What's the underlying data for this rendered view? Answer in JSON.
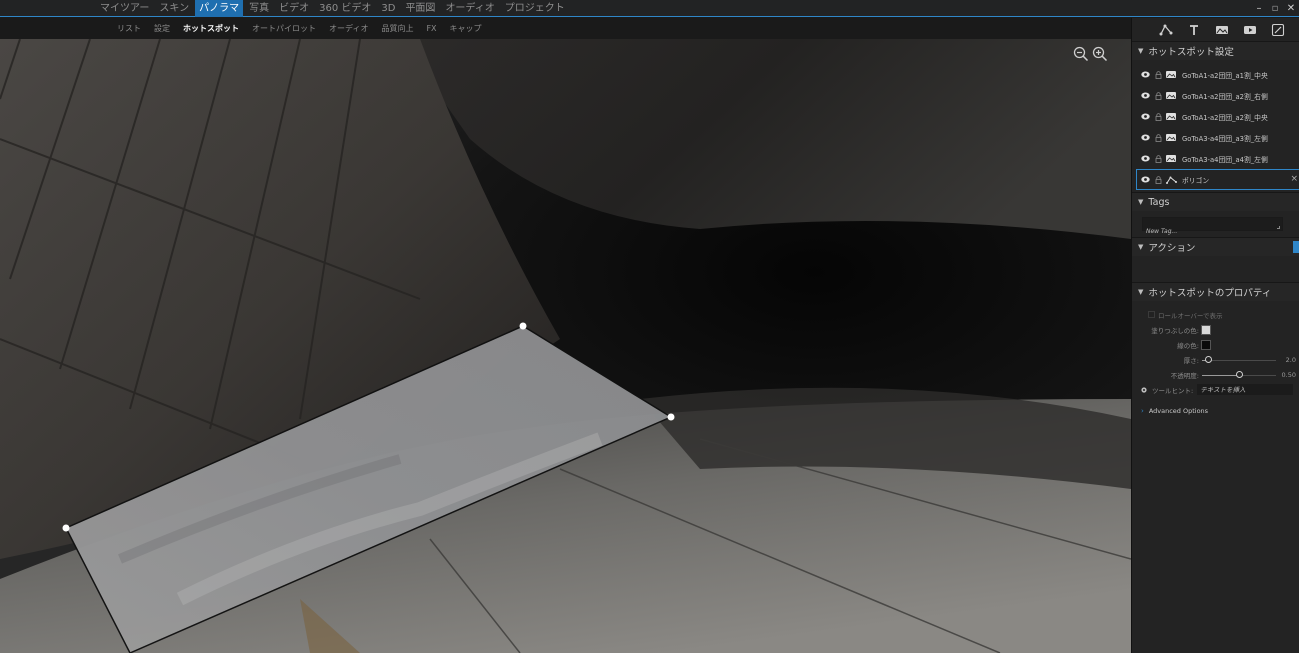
{
  "colors": {
    "accent": "#2f86c8",
    "activeTab": "#1f6fb0",
    "panel": "#232323",
    "topbar": "#222324"
  },
  "topnav": {
    "items": [
      {
        "label": "マイツアー",
        "active": false
      },
      {
        "label": "スキン",
        "active": false
      },
      {
        "label": "パノラマ",
        "active": true
      },
      {
        "label": "写真",
        "active": false
      },
      {
        "label": "ビデオ",
        "active": false
      },
      {
        "label": "360 ビデオ",
        "active": false
      },
      {
        "label": "3D",
        "active": false
      },
      {
        "label": "平面図",
        "active": false
      },
      {
        "label": "オーディオ",
        "active": false
      },
      {
        "label": "プロジェクト",
        "active": false
      }
    ]
  },
  "window": {
    "minimize": "–",
    "restore": "▫",
    "close": "✕"
  },
  "subtabs": {
    "items": [
      {
        "label": "リスト",
        "active": false
      },
      {
        "label": "設定",
        "active": false
      },
      {
        "label": "ホットスポット",
        "active": true
      },
      {
        "label": "オートパイロット",
        "active": false
      },
      {
        "label": "オーディオ",
        "active": false
      },
      {
        "label": "品質向上",
        "active": false
      },
      {
        "label": "FX",
        "active": false
      },
      {
        "label": "キャップ",
        "active": false
      }
    ]
  },
  "viewport": {
    "zoom_out_icon": "zoom-out-icon",
    "zoom_in_icon": "zoom-in-icon"
  },
  "panel": {
    "toolbar_icons": [
      "polygon-icon",
      "text-icon",
      "image-icon",
      "video-icon",
      "edit-icon"
    ],
    "hotspot_settings": {
      "title": "ホットスポット設定",
      "items": [
        {
          "name": "GoToA1-a2団団_a1割_中央",
          "type": "image"
        },
        {
          "name": "GoToA1-a2団団_a2割_右側",
          "type": "image"
        },
        {
          "name": "GoToA1-a2団団_a2割_中央",
          "type": "image"
        },
        {
          "name": "GoToA3-a4団団_a3割_左側",
          "type": "image"
        },
        {
          "name": "GoToA3-a4団団_a4割_左側",
          "type": "image"
        },
        {
          "name": "ポリゴン",
          "type": "polygon",
          "selected": true
        }
      ],
      "close_label": "×"
    },
    "tags": {
      "title": "Tags",
      "placeholder": "New Tag..."
    },
    "action": {
      "title": "アクション"
    },
    "properties": {
      "title": "ホットスポットのプロパティ",
      "rollover_label": "ロールオーバーで表示",
      "rollover_checked": false,
      "fill_color_label": "塗りつぶしの色:",
      "fill_color": "#d8d8d8",
      "border_color_label": "線の色:",
      "border_color": "#0a0a0a",
      "thickness_label": "厚さ:",
      "thickness_value": "2.0",
      "thickness_fraction": 0.05,
      "opacity_label": "不透明度:",
      "opacity_value": "0.50",
      "opacity_fraction": 0.5,
      "tooltip_label": "ツールヒント:",
      "tooltip_placeholder": "テキストを挿入",
      "advanced_label": "Advanced Options"
    }
  }
}
